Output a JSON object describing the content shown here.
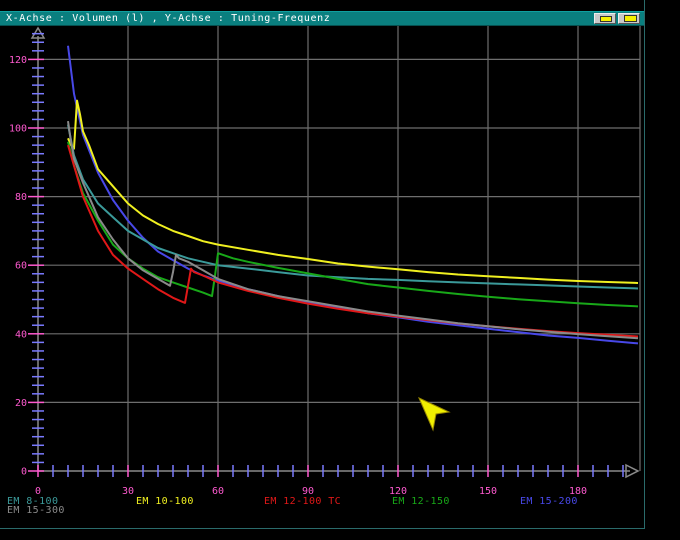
{
  "window": {
    "title": "X-Achse : Volumen (l) , Y-Achse : Tuning-Frequenz",
    "title_color": "#0a7f7f",
    "buttons": [
      "iconify-button",
      "fullscreen-button"
    ]
  },
  "legend": [
    {
      "label": "EM 8-100",
      "color": "#3b9a9a"
    },
    {
      "label": "EM 10-100",
      "color": "#f0f020"
    },
    {
      "label": "EM 12-100 TC",
      "color": "#e01818"
    },
    {
      "label": "EM 12-150",
      "color": "#18a818"
    },
    {
      "label": "EM 15-200",
      "color": "#4848e8"
    },
    {
      "label": "EM 15-300",
      "color": "#8a8a8a"
    }
  ],
  "chart_data": {
    "type": "line",
    "xlabel": "Volumen (l)",
    "ylabel": "Tuning-Frequenz",
    "xlim": [
      0,
      200
    ],
    "ylim": [
      0,
      130
    ],
    "xticks": [
      0,
      30,
      60,
      90,
      120,
      150,
      180
    ],
    "yticks": [
      0,
      20,
      40,
      60,
      80,
      100,
      120
    ],
    "grid": true,
    "axis_color": "#ff5ad0",
    "minor_tick_color": "#7a7aff",
    "series": [
      {
        "name": "EM 15-200",
        "color": "#4848e8",
        "points": [
          [
            10,
            124
          ],
          [
            12,
            110
          ],
          [
            15,
            98
          ],
          [
            20,
            87
          ],
          [
            25,
            79
          ],
          [
            30,
            73
          ],
          [
            35,
            68
          ],
          [
            40,
            64
          ],
          [
            45,
            61.5
          ],
          [
            50,
            59
          ],
          [
            55,
            57
          ],
          [
            60,
            55.5
          ],
          [
            70,
            53
          ],
          [
            80,
            51
          ],
          [
            90,
            49
          ],
          [
            100,
            47.5
          ],
          [
            110,
            46
          ],
          [
            120,
            44.8
          ],
          [
            130,
            43.5
          ],
          [
            140,
            42.5
          ],
          [
            150,
            41.5
          ],
          [
            160,
            40.5
          ],
          [
            170,
            39.5
          ],
          [
            180,
            38.8
          ],
          [
            190,
            38
          ],
          [
            200,
            37.2
          ]
        ]
      },
      {
        "name": "EM 10-100",
        "color": "#f0f020",
        "points": [
          [
            10,
            97
          ],
          [
            11,
            95
          ],
          [
            12,
            94
          ],
          [
            13,
            108
          ],
          [
            14,
            104
          ],
          [
            15,
            99
          ],
          [
            17,
            95
          ],
          [
            20,
            88
          ],
          [
            25,
            83
          ],
          [
            30,
            78
          ],
          [
            35,
            74.5
          ],
          [
            40,
            72
          ],
          [
            45,
            70
          ],
          [
            50,
            68.5
          ],
          [
            55,
            67
          ],
          [
            60,
            66
          ],
          [
            70,
            64.5
          ],
          [
            80,
            63
          ],
          [
            90,
            61.8
          ],
          [
            100,
            60.5
          ],
          [
            110,
            59.6
          ],
          [
            120,
            58.8
          ],
          [
            130,
            58
          ],
          [
            140,
            57.3
          ],
          [
            150,
            56.8
          ],
          [
            160,
            56.3
          ],
          [
            170,
            55.8
          ],
          [
            180,
            55.4
          ],
          [
            190,
            55.1
          ],
          [
            200,
            54.8
          ]
        ]
      },
      {
        "name": "EM 8-100",
        "color": "#3b9a9a",
        "points": [
          [
            10,
            101
          ],
          [
            12,
            92
          ],
          [
            15,
            85
          ],
          [
            20,
            78
          ],
          [
            25,
            74
          ],
          [
            30,
            70
          ],
          [
            35,
            67.5
          ],
          [
            40,
            65
          ],
          [
            45,
            63.5
          ],
          [
            50,
            62
          ],
          [
            55,
            61
          ],
          [
            60,
            60
          ],
          [
            70,
            59
          ],
          [
            80,
            58
          ],
          [
            90,
            57
          ],
          [
            100,
            56.5
          ],
          [
            110,
            56
          ],
          [
            120,
            55.7
          ],
          [
            130,
            55.3
          ],
          [
            140,
            55
          ],
          [
            150,
            54.7
          ],
          [
            160,
            54.4
          ],
          [
            170,
            54.1
          ],
          [
            180,
            53.8
          ],
          [
            190,
            53.5
          ],
          [
            200,
            53.2
          ]
        ]
      },
      {
        "name": "EM 12-150",
        "color": "#18a818",
        "points": [
          [
            10,
            96
          ],
          [
            12,
            89
          ],
          [
            15,
            81
          ],
          [
            20,
            73
          ],
          [
            25,
            66
          ],
          [
            30,
            62
          ],
          [
            35,
            59
          ],
          [
            40,
            56.5
          ],
          [
            45,
            55
          ],
          [
            50,
            53.5
          ],
          [
            55,
            52
          ],
          [
            58,
            51
          ],
          [
            59,
            57
          ],
          [
            60,
            63.5
          ],
          [
            65,
            62
          ],
          [
            70,
            61
          ],
          [
            80,
            59.2
          ],
          [
            90,
            57.6
          ],
          [
            100,
            56
          ],
          [
            110,
            54.5
          ],
          [
            120,
            53.5
          ],
          [
            130,
            52.5
          ],
          [
            140,
            51.6
          ],
          [
            150,
            50.8
          ],
          [
            160,
            50.1
          ],
          [
            170,
            49.5
          ],
          [
            180,
            48.9
          ],
          [
            190,
            48.4
          ],
          [
            200,
            48
          ]
        ]
      },
      {
        "name": "EM 12-100 TC",
        "color": "#e01818",
        "points": [
          [
            10,
            95
          ],
          [
            12,
            89
          ],
          [
            15,
            80
          ],
          [
            20,
            70
          ],
          [
            25,
            63
          ],
          [
            30,
            59
          ],
          [
            35,
            56
          ],
          [
            40,
            53
          ],
          [
            45,
            50.5
          ],
          [
            49,
            49
          ],
          [
            50,
            54
          ],
          [
            51,
            59
          ],
          [
            52,
            58
          ],
          [
            55,
            57
          ],
          [
            60,
            55
          ],
          [
            70,
            52.5
          ],
          [
            80,
            50.5
          ],
          [
            90,
            48.8
          ],
          [
            100,
            47.3
          ],
          [
            110,
            46
          ],
          [
            120,
            45
          ],
          [
            130,
            44
          ],
          [
            140,
            43
          ],
          [
            150,
            42.2
          ],
          [
            160,
            41.5
          ],
          [
            170,
            40.8
          ],
          [
            180,
            40.2
          ],
          [
            190,
            39.7
          ],
          [
            200,
            39.2
          ]
        ]
      },
      {
        "name": "EM 15-300",
        "color": "#8a8a8a",
        "points": [
          [
            10,
            102
          ],
          [
            11,
            96
          ],
          [
            12,
            91
          ],
          [
            15,
            84
          ],
          [
            20,
            74
          ],
          [
            25,
            67.5
          ],
          [
            30,
            62
          ],
          [
            35,
            58.5
          ],
          [
            40,
            56
          ],
          [
            44,
            54
          ],
          [
            45,
            58
          ],
          [
            46,
            63
          ],
          [
            47,
            62
          ],
          [
            50,
            61
          ],
          [
            55,
            58.5
          ],
          [
            60,
            56
          ],
          [
            70,
            53
          ],
          [
            80,
            51
          ],
          [
            90,
            49.5
          ],
          [
            100,
            48
          ],
          [
            110,
            46.5
          ],
          [
            120,
            45.3
          ],
          [
            130,
            44.2
          ],
          [
            140,
            43.1
          ],
          [
            150,
            42.2
          ],
          [
            160,
            41.3
          ],
          [
            170,
            40.6
          ],
          [
            180,
            39.9
          ],
          [
            190,
            39.3
          ],
          [
            200,
            38.7
          ]
        ]
      }
    ]
  }
}
